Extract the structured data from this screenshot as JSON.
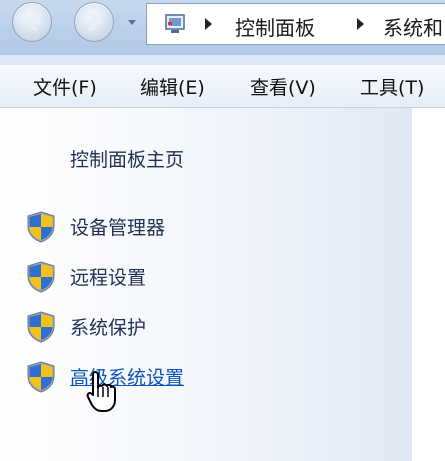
{
  "address_bar": {
    "crumbs": [
      "控制面板",
      "系统和"
    ]
  },
  "menu": {
    "items": [
      "文件(F)",
      "编辑(E)",
      "查看(V)",
      "工具(T)"
    ]
  },
  "task_pane": {
    "home_link": "控制面板主页",
    "links": [
      "设备管理器",
      "远程设置",
      "系统保护",
      "高级系统设置"
    ]
  },
  "colors": {
    "link": "#1f3154",
    "link_hover": "#0a53b8"
  },
  "icons": [
    "back-arrow-icon",
    "forward-arrow-icon",
    "control-panel-icon",
    "shield-icon",
    "hand-cursor-icon"
  ]
}
